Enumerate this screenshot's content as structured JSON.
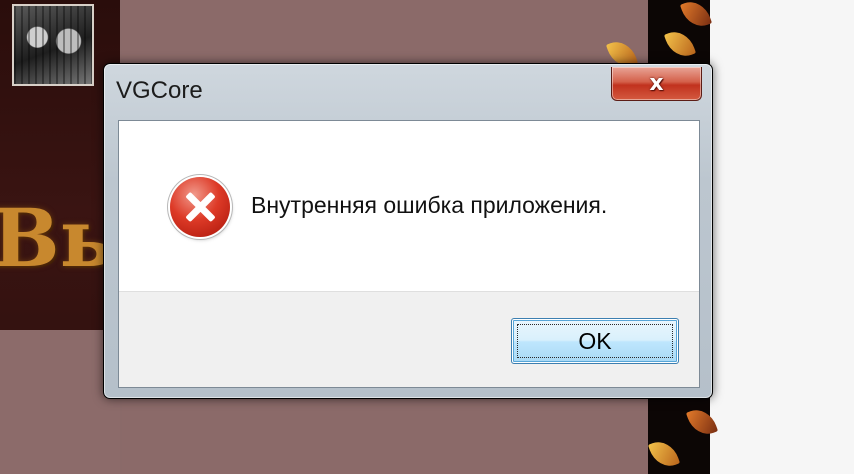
{
  "background": {
    "letters": "Вь"
  },
  "dialog": {
    "title": "VGCore",
    "close_glyph": "x",
    "message": "Внутренняя ошибка приложения.",
    "icon": "error-icon",
    "ok_label": "OK"
  },
  "colors": {
    "close_button": "#c1321e",
    "error_icon": "#dd3a27",
    "ok_border": "#3c7fb1"
  }
}
